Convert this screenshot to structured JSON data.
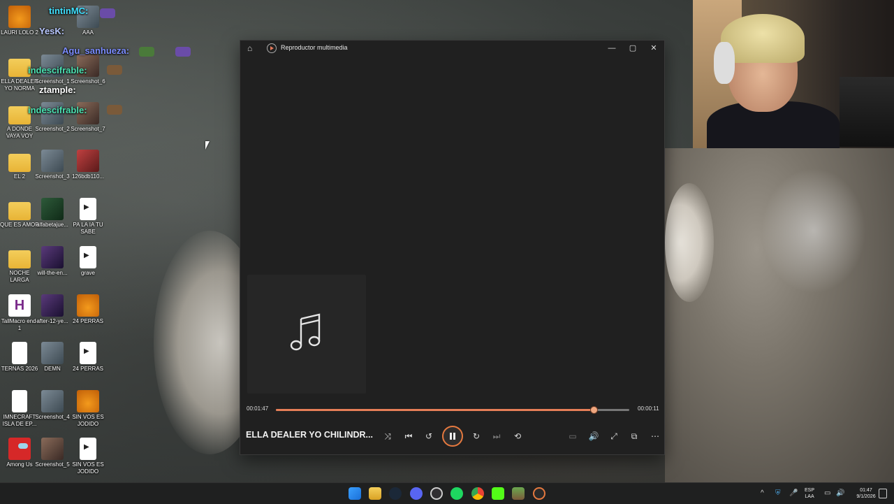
{
  "desktop": {
    "icons": [
      {
        "label": "LAURI LOLO 2",
        "type": "fl"
      },
      {
        "label": "AAA",
        "type": "thumb"
      },
      {
        "label": "ELLA DEALER YO NORMA",
        "type": "folder"
      },
      {
        "label": "Screenshot_1",
        "type": "thumb"
      },
      {
        "label": "Screenshot_6",
        "type": "thumb2"
      },
      {
        "label": "A DONDE VAYA VOY",
        "type": "folder"
      },
      {
        "label": "Screenshot_2",
        "type": "thumb"
      },
      {
        "label": "Screenshot_7",
        "type": "thumb2"
      },
      {
        "label": "EL 2",
        "type": "folder"
      },
      {
        "label": "Screenshot_3",
        "type": "thumb"
      },
      {
        "label": "126bdb110...",
        "type": "thumb5"
      },
      {
        "label": "QUE ES AMOR",
        "type": "folder"
      },
      {
        "label": "alfabetajue...",
        "type": "thumb4"
      },
      {
        "label": "PA LA IA TU SABE",
        "type": "media"
      },
      {
        "label": "NOCHE LARGA",
        "type": "folder"
      },
      {
        "label": "will-the-en...",
        "type": "thumb3"
      },
      {
        "label": "grave",
        "type": "media"
      },
      {
        "label": "TallMacro end-1",
        "type": "hicon"
      },
      {
        "label": "after-12-ye...",
        "type": "thumb3"
      },
      {
        "label": "24 PERRAS",
        "type": "fl"
      },
      {
        "label": "TERNAS 2026",
        "type": "doc"
      },
      {
        "label": "DEMN",
        "type": "thumb"
      },
      {
        "label": "24 PERRAS",
        "type": "media"
      },
      {
        "label": "IMNECRAFT ISLA DE EP...",
        "type": "doc"
      },
      {
        "label": "Screenshot_4",
        "type": "thumb"
      },
      {
        "label": "SIN VOS ES JODIDO",
        "type": "fl"
      },
      {
        "label": "Among Us",
        "type": "amongus"
      },
      {
        "label": "Screenshot_5",
        "type": "thumb2"
      },
      {
        "label": "SIN VOS ES JODIDO",
        "type": "media"
      }
    ]
  },
  "chat": [
    {
      "name": "tintinMC:",
      "color": "#3fe0ff"
    },
    {
      "name": "YesK:",
      "color": "#b9c7ff"
    },
    {
      "name": "Agu_sanhueza:",
      "color": "#7b8cff"
    },
    {
      "name": "indescifrable:",
      "color": "#4be0b0"
    },
    {
      "name": "ztample:",
      "color": "#ffffff"
    },
    {
      "name": "indescifrable:",
      "color": "#4be0b0"
    }
  ],
  "player": {
    "title": "Reproductor multimedia",
    "window_controls": {
      "minimize": "—",
      "maximize": "▢",
      "close": "✕"
    },
    "track_title": "ELLA DEALER YO CHILINDR...",
    "elapsed": "00:01:47",
    "remaining": "00:00:11",
    "progress_fraction": 0.9,
    "accent_color": "#e67e57",
    "icons": {
      "home": "⌂",
      "shuffle": "⤨",
      "previous": "⏮",
      "rewind": "↺",
      "forward": "↻",
      "next": "⏭",
      "repeat": "⟲",
      "miniplayer": "▭",
      "volume": "🔊",
      "fullscreen": "⤢",
      "cast": "⧉",
      "more": "⋯"
    }
  },
  "taskbar": {
    "apps": [
      "windows-start",
      "file-explorer",
      "steam",
      "discord",
      "obs",
      "spotify",
      "chrome",
      "kick",
      "minecraft",
      "media-player"
    ],
    "lang_top": "ESP",
    "lang_bottom": "LAA",
    "time": "01:47",
    "date": "9/1/2026",
    "tray_icons": {
      "chevron": "^",
      "defender": "⛨",
      "mic": "🎤",
      "display": "▭",
      "volume": "🔊"
    }
  }
}
